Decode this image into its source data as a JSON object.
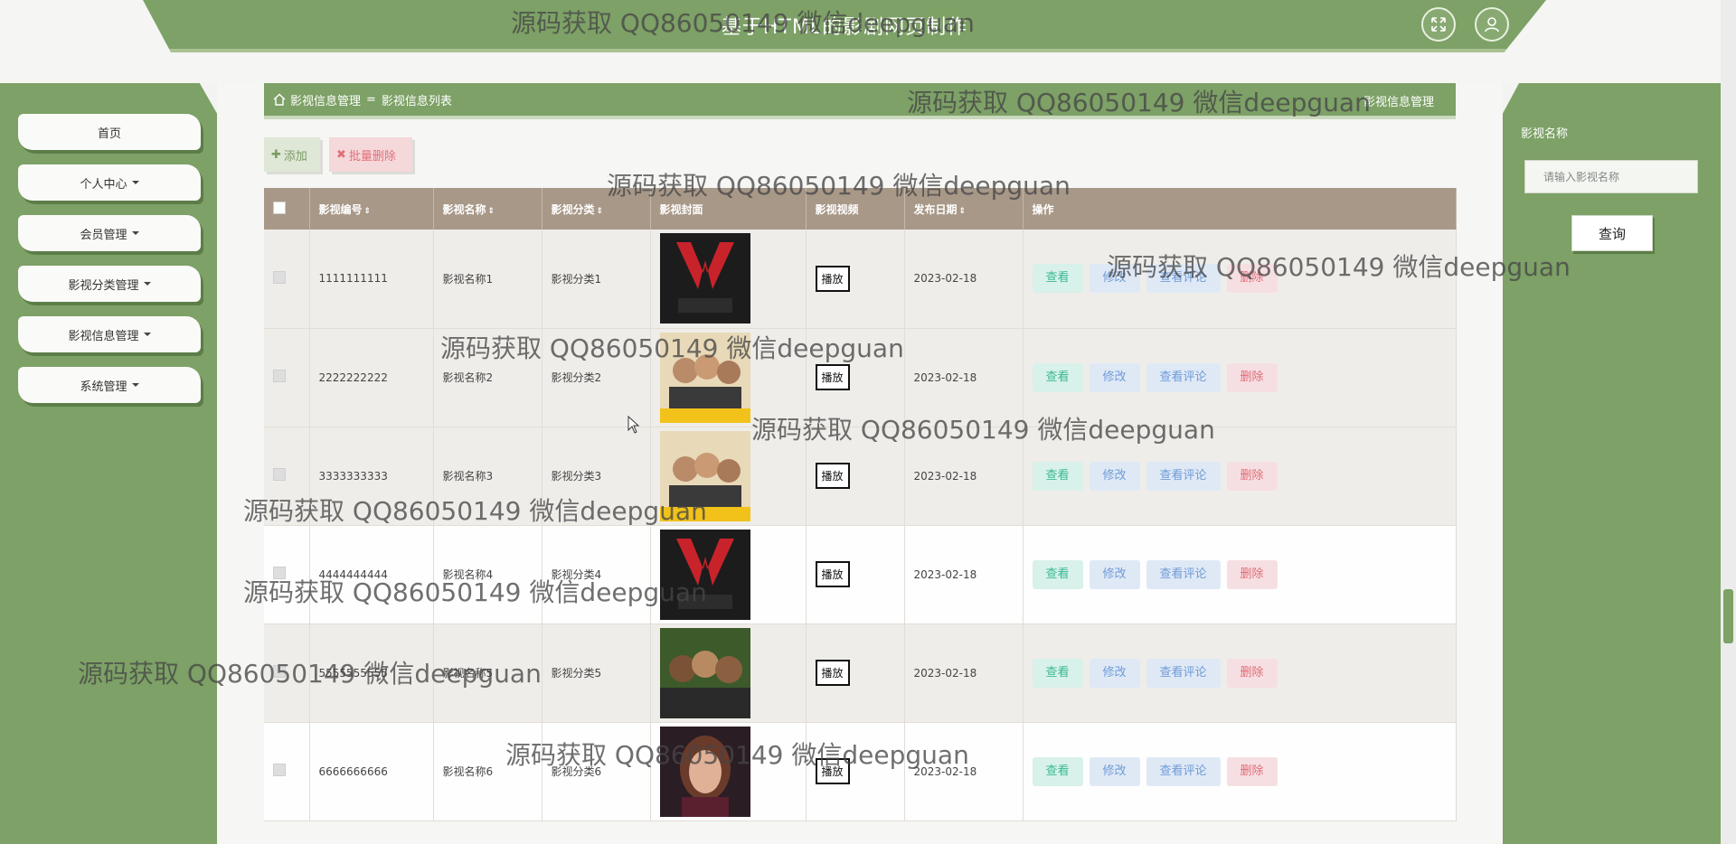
{
  "header": {
    "title": "基于HTML的影剧网页制作",
    "fullscreen_icon": "expand-icon",
    "user_icon": "user-icon"
  },
  "sidebar": {
    "items": [
      {
        "label": "首页",
        "has_dropdown": false
      },
      {
        "label": "个人中心",
        "has_dropdown": true
      },
      {
        "label": "会员管理",
        "has_dropdown": true
      },
      {
        "label": "影视分类管理",
        "has_dropdown": true
      },
      {
        "label": "影视信息管理",
        "has_dropdown": true
      },
      {
        "label": "系统管理",
        "has_dropdown": true
      }
    ]
  },
  "breadcrumb": {
    "home": "影视信息管理",
    "separator": "=",
    "current": "影视信息列表",
    "right_title": "影视信息管理"
  },
  "toolbar": {
    "add_label": "添加",
    "batch_delete_label": "批量删除"
  },
  "table": {
    "headers": [
      "影视编号",
      "影视名称",
      "影视分类",
      "影视封面",
      "影视视频",
      "发布日期",
      "操作"
    ],
    "play_label": "播放",
    "actions": {
      "view": "查看",
      "edit": "修改",
      "comments": "查看评论",
      "delete": "删除"
    },
    "rows": [
      {
        "id": "1111111111",
        "name": "影视名称1",
        "category": "影视分类1",
        "date": "2023-02-18"
      },
      {
        "id": "2222222222",
        "name": "影视名称2",
        "category": "影视分类2",
        "date": "2023-02-18"
      },
      {
        "id": "3333333333",
        "name": "影视名称3",
        "category": "影视分类3",
        "date": "2023-02-18"
      },
      {
        "id": "4444444444",
        "name": "影视名称4",
        "category": "影视分类4",
        "date": "2023-02-18"
      },
      {
        "id": "5555555555",
        "name": "影视名称5",
        "category": "影视分类5",
        "date": "2023-02-18"
      },
      {
        "id": "6666666666",
        "name": "影视名称6",
        "category": "影视分类6",
        "date": "2023-02-18"
      }
    ]
  },
  "search": {
    "label": "影视名称",
    "placeholder": "请输入影视名称",
    "button": "查询"
  },
  "watermark": "源码获取 QQ86050149 微信deepguan",
  "colors": {
    "primary": "#7da166",
    "table_header": "#a89888"
  }
}
